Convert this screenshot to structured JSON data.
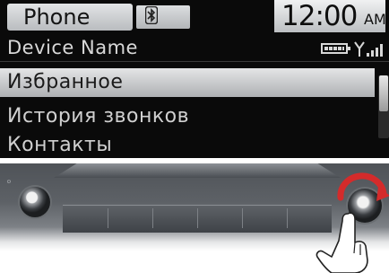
{
  "status_bar": {
    "app_title": "Phone",
    "bluetooth_icon": "bluetooth-icon",
    "time": "12:00",
    "ampm": "AM"
  },
  "device": {
    "name": "Device Name",
    "battery_icon": "battery-icon",
    "signal_icon": "signal-strength-icon"
  },
  "menu": {
    "items": [
      {
        "label": "Избранное",
        "selected": true
      },
      {
        "label": "История звонков",
        "selected": false
      },
      {
        "label": "Контакты",
        "selected": false
      }
    ]
  },
  "colors": {
    "screen_background": "#0a0a0a",
    "highlight": "#c9cbcd",
    "text_light": "#d8d8d8",
    "knob_arrow": "#d42b2b"
  },
  "panel": {
    "knob_left_icon": "power-volume-knob",
    "knob_right_icon": "tune-knob",
    "rotate_icon": "rotate-arrow-icon",
    "hand_icon": "hand-pointer-icon"
  }
}
